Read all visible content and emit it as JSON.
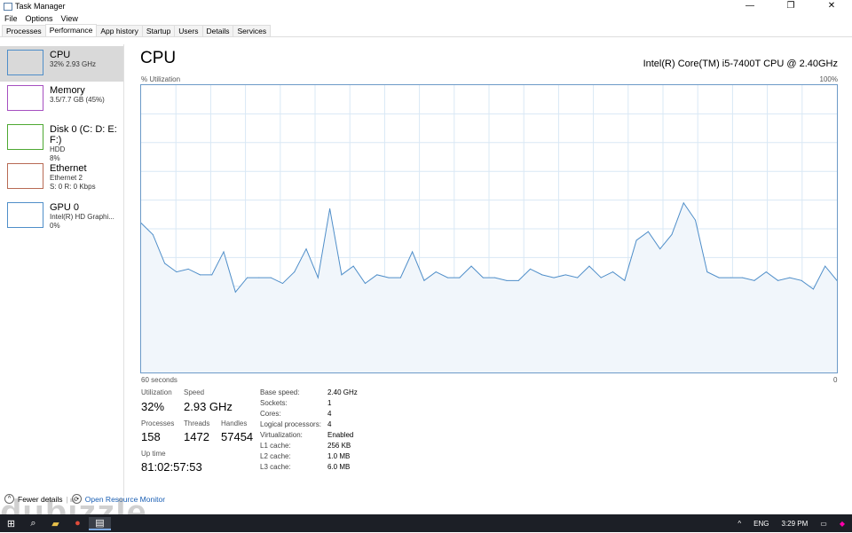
{
  "window": {
    "title": "Task Manager",
    "controls": [
      "—",
      "❐",
      "✕"
    ]
  },
  "menu": [
    "File",
    "Options",
    "View"
  ],
  "tabs": [
    "Processes",
    "Performance",
    "App history",
    "Startup",
    "Users",
    "Details",
    "Services"
  ],
  "active_tab": "Performance",
  "sidebar": [
    {
      "title": "CPU",
      "sub1": "32% 2.93 GHz",
      "sub2": "",
      "color": "#4f8ec9"
    },
    {
      "title": "Memory",
      "sub1": "3.5/7.7 GB (45%)",
      "sub2": "",
      "color": "#a64fc0"
    },
    {
      "title": "Disk 0 (C: D: E: F:)",
      "sub1": "HDD",
      "sub2": "8%",
      "color": "#4da832"
    },
    {
      "title": "Ethernet",
      "sub1": "Ethernet 2",
      "sub2": "S: 0 R: 0 Kbps",
      "color": "#b86a54"
    },
    {
      "title": "GPU 0",
      "sub1": "Intel(R) HD Graphi...",
      "sub2": "0%",
      "color": "#4f8ec9"
    }
  ],
  "main": {
    "title": "CPU",
    "model": "Intel(R) Core(TM) i5-7400T CPU @ 2.40GHz",
    "y_label": "% Utilization",
    "y_max_label": "100%",
    "x_left_label": "60 seconds",
    "x_right_label": "0"
  },
  "chart_data": {
    "type": "area",
    "ylim": [
      0,
      100
    ],
    "grid": true,
    "color": "#4f8ec9",
    "values": [
      52,
      48,
      38,
      35,
      36,
      34,
      34,
      42,
      28,
      33,
      33,
      33,
      31,
      35,
      43,
      33,
      57,
      34,
      37,
      31,
      34,
      33,
      33,
      42,
      32,
      35,
      33,
      33,
      37,
      33,
      33,
      32,
      32,
      36,
      34,
      33,
      34,
      33,
      37,
      33,
      35,
      32,
      46,
      49,
      43,
      48,
      59,
      53,
      35,
      33,
      33,
      33,
      32,
      35,
      32,
      33,
      32,
      29,
      37,
      32
    ]
  },
  "stats": {
    "utilization": {
      "label": "Utilization",
      "value": "32%"
    },
    "speed": {
      "label": "Speed",
      "value": "2.93 GHz"
    },
    "processes": {
      "label": "Processes",
      "value": "158"
    },
    "threads": {
      "label": "Threads",
      "value": "1472"
    },
    "handles": {
      "label": "Handles",
      "value": "57454"
    },
    "uptime": {
      "label": "Up time",
      "value": "81:02:57:53"
    }
  },
  "specs": [
    [
      "Base speed:",
      "2.40 GHz"
    ],
    [
      "Sockets:",
      "1"
    ],
    [
      "Cores:",
      "4"
    ],
    [
      "Logical processors:",
      "4"
    ],
    [
      "Virtualization:",
      "Enabled"
    ],
    [
      "L1 cache:",
      "256 KB"
    ],
    [
      "L2 cache:",
      "1.0 MB"
    ],
    [
      "L3 cache:",
      "6.0 MB"
    ]
  ],
  "footer": {
    "fewer": "Fewer details",
    "monitor": "Open Resource Monitor"
  },
  "watermark": "dubizzle",
  "taskbar": {
    "lang": "ENG",
    "time": "3:29 PM"
  }
}
